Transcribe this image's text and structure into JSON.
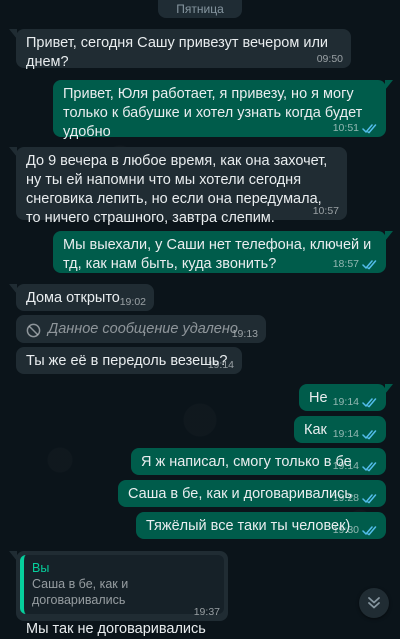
{
  "date_chip": "Пятница",
  "colors": {
    "background": "#0b141a",
    "incoming_bubble": "#202c33",
    "outgoing_bubble": "#005c4b",
    "read_ticks": "#53bdeb",
    "reply_accent": "#06cf9c"
  },
  "messages": [
    {
      "text": "Привет, сегодня Сашу привезут вечером или днем?",
      "time": "09:50"
    },
    {
      "text": "Привет, Юля работает, я привезу, но я могу только к бабушке и хотел узнать когда будет удобно",
      "time": "10:51",
      "status_icon": "double-check-read-icon"
    },
    {
      "text": "До 9 вечера в любое время, как она захочет, ну ты ей напомни что мы хотели сегодня снеговика лепить, но если она передумала, то ничего страшного, завтра слепим.",
      "time": "10:57"
    },
    {
      "text": "Мы выехали, у Саши нет телефона, ключей и тд, как нам быть, куда звонить?",
      "time": "18:57",
      "status_icon": "double-check-read-icon"
    },
    {
      "text": "Дома открыто",
      "time": "19:02"
    },
    {
      "text": "Данное сообщение удалено",
      "time": "19:13",
      "icon": "deleted-circle-icon"
    },
    {
      "text": "Ты же её в передоль везешь?",
      "time": "19:14"
    },
    {
      "text": "Не",
      "time": "19:14",
      "status_icon": "double-check-read-icon"
    },
    {
      "text": "Как",
      "time": "19:14",
      "status_icon": "double-check-read-icon"
    },
    {
      "text": "Я ж написал, смогу только в бе",
      "time": "19:14",
      "status_icon": "double-check-read-icon"
    },
    {
      "text": "Саша в бе, как и договаривались",
      "time": "19:28",
      "status_icon": "double-check-read-icon"
    },
    {
      "text": "Тяжёлый все таки ты человек)",
      "time": "19:30",
      "status_icon": "double-check-read-icon"
    },
    {
      "reply": {
        "author": "Вы",
        "text": "Саша в бе, как и договаривались"
      },
      "text": "Мы так не договаривались",
      "time": "19:37"
    }
  ],
  "scroll_button_icon": "double-chevron-down-icon"
}
